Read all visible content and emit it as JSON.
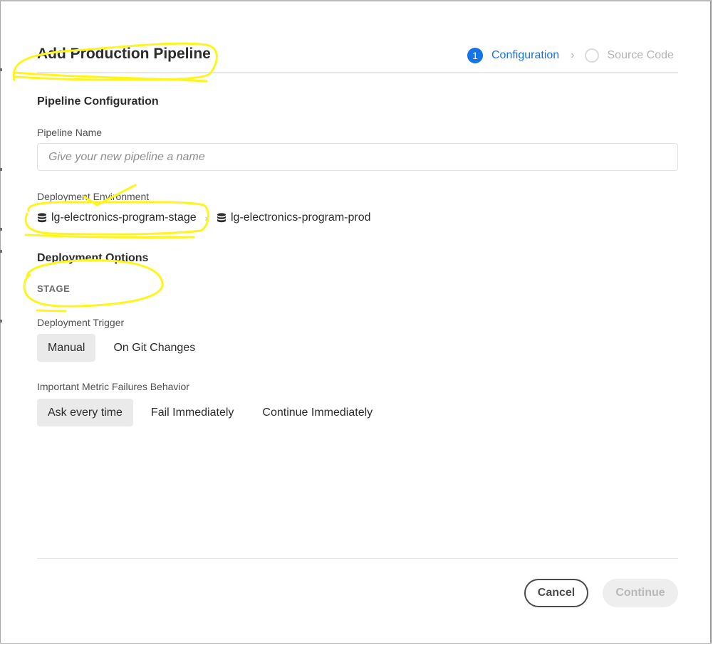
{
  "dialog": {
    "title": "Add Production Pipeline"
  },
  "stepper": {
    "steps": [
      {
        "number": "1",
        "label": "Configuration",
        "state": "active"
      },
      {
        "number": "",
        "label": "Source Code",
        "state": "inactive"
      }
    ],
    "separator_icon": "chevron-right-icon"
  },
  "pipeline_config": {
    "heading": "Pipeline Configuration",
    "name_label": "Pipeline Name",
    "name_placeholder": "Give your new pipeline a name",
    "name_value": ""
  },
  "deployment_environment": {
    "label": "Deployment Environment",
    "environments": [
      {
        "icon": "database-icon",
        "name": "lg-electronics-program-stage"
      },
      {
        "icon": "database-icon",
        "name": "lg-electronics-program-prod"
      }
    ]
  },
  "deployment_options": {
    "heading": "Deployment Options",
    "stage_label": "STAGE",
    "trigger": {
      "label": "Deployment Trigger",
      "options": [
        "Manual",
        "On Git Changes"
      ],
      "selected": "Manual"
    },
    "metric_failures": {
      "label": "Important Metric Failures Behavior",
      "options": [
        "Ask every time",
        "Fail Immediately",
        "Continue Immediately"
      ],
      "selected": "Ask every time"
    }
  },
  "footer": {
    "cancel_label": "Cancel",
    "continue_label": "Continue"
  },
  "colors": {
    "accent": "#1473e6",
    "annotation_highlight": "#fdf51c",
    "selected_option_bg": "#eaeaea"
  }
}
